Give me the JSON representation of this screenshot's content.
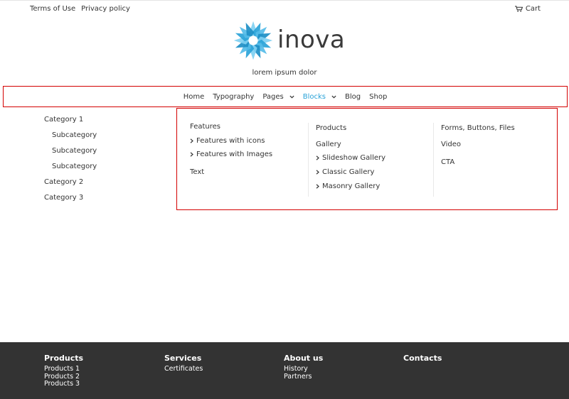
{
  "top_bar": {
    "links": [
      "Terms of Use",
      "Privacy policy"
    ],
    "cart_label": "Cart"
  },
  "brand": {
    "name": "inova",
    "tagline": "lorem ipsum dolor",
    "accent_color": "#2aa3d8"
  },
  "nav": {
    "items": [
      "Home",
      "Typography",
      "Pages",
      "Blocks",
      "Blog",
      "Shop"
    ],
    "active": "Blocks"
  },
  "sidebar": {
    "categories": [
      {
        "label": "Category 1",
        "level": 0
      },
      {
        "label": "Subcategory",
        "level": 1
      },
      {
        "label": "Subcategory",
        "level": 1
      },
      {
        "label": "Subcategory",
        "level": 1
      },
      {
        "label": "Category 2",
        "level": 0
      },
      {
        "label": "Category 3",
        "level": 0
      }
    ]
  },
  "mega_menu": {
    "col1": {
      "features": "Features",
      "features_icons": "Features with icons",
      "features_images": "Features with Images",
      "text": "Text"
    },
    "col2": {
      "products": "Products",
      "gallery": "Gallery",
      "slideshow": "Slideshow Gallery",
      "classic": "Classic Gallery",
      "masonry": "Masonry Gallery"
    },
    "col3": {
      "forms": "Forms, Buttons, Files",
      "video": "Video",
      "cta": "CTA"
    }
  },
  "footer": {
    "columns": [
      {
        "title": "Products",
        "links": [
          "Products 1",
          "Products 2",
          "Products 3"
        ]
      },
      {
        "title": "Services",
        "links": [
          "Certificates"
        ]
      },
      {
        "title": "About us",
        "links": [
          "History",
          "Partners"
        ]
      },
      {
        "title": "Contacts",
        "links": []
      }
    ]
  }
}
